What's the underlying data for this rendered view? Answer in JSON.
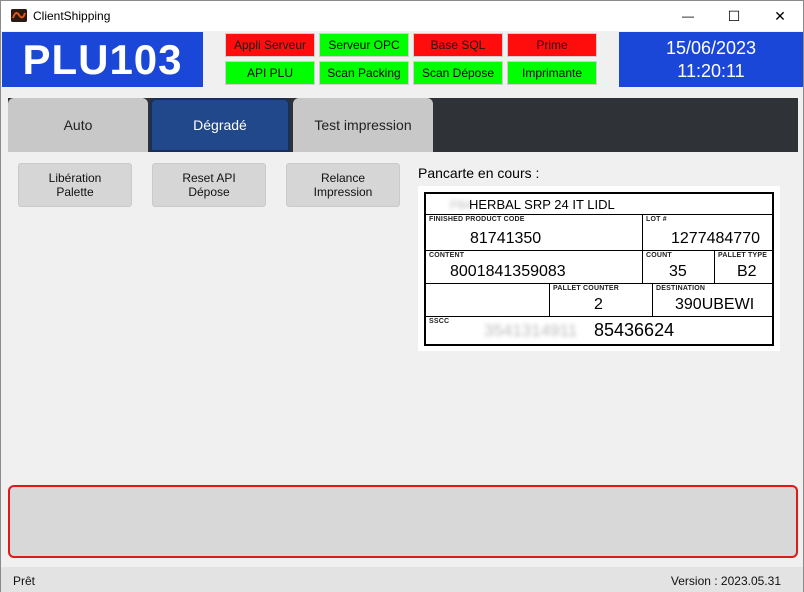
{
  "window": {
    "title": "ClientShipping",
    "minimize_glyph": "—",
    "maximize_glyph": "☐",
    "close_glyph": "✕"
  },
  "header": {
    "plu": "PLU103",
    "date": "15/06/2023",
    "time": "11:20:11",
    "indicators": [
      {
        "label": "Appli Serveur",
        "status": "error",
        "color": "#ff0c0c"
      },
      {
        "label": "Serveur OPC",
        "status": "ok",
        "color": "#00ff00"
      },
      {
        "label": "Base SQL",
        "status": "error",
        "color": "#ff0c0c"
      },
      {
        "label": "Prime",
        "status": "error",
        "color": "#ff0c0c"
      },
      {
        "label": "API PLU",
        "status": "ok",
        "color": "#00ff00"
      },
      {
        "label": "Scan Packing",
        "status": "ok",
        "color": "#00ff00"
      },
      {
        "label": "Scan Dépose",
        "status": "ok",
        "color": "#00ff00"
      },
      {
        "label": "Imprimante",
        "status": "ok",
        "color": "#00ff00"
      }
    ]
  },
  "tabs": [
    {
      "label": "Auto",
      "active": false
    },
    {
      "label": "Dégradé",
      "active": true
    },
    {
      "label": "Test impression",
      "active": false
    }
  ],
  "actions": {
    "liberation_line1": "Libération",
    "liberation_line2": "Palette",
    "reset_line1": "Reset API",
    "reset_line2": "Dépose",
    "relance_line1": "Relance",
    "relance_line2": "Impression"
  },
  "placard": {
    "title": "Pancarte en cours :",
    "product_prefix": "P84",
    "product_name": "HERBAL SRP 24 IT LIDL",
    "finished_product_code_label": "FINISHED PRODUCT CODE",
    "finished_product_code": "81741350",
    "lot_label": "LOT #",
    "lot": "1277484770",
    "content_label": "CONTENT",
    "content": "8001841359083",
    "count_label": "COUNT",
    "count": "35",
    "pallet_type_label": "PALLET TYPE",
    "pallet_type": "B2",
    "pallet_counter_label": "PALLET COUNTER",
    "pallet_counter": "2",
    "destination_label": "DESTINATION",
    "destination": "390UBEWI",
    "sscc_label": "SSCC",
    "sscc_blurred": "3541314911",
    "sscc_visible": "85436624"
  },
  "statusbar": {
    "status": "Prêt",
    "version": "Version : 2023.05.31"
  },
  "colors": {
    "header_blue": "#1a47d8",
    "tab_active": "#20488a",
    "tabbar_bg": "#2f3237",
    "message_border": "#e01818"
  }
}
